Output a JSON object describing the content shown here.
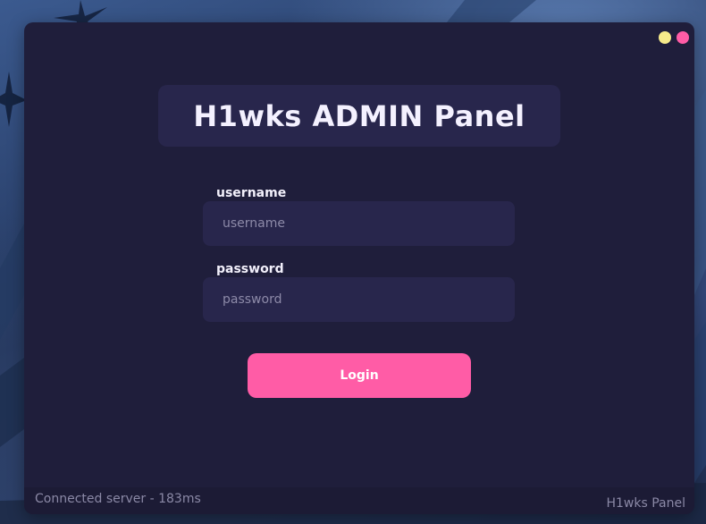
{
  "window": {
    "title": "H1wks ADMIN Panel",
    "controls": {
      "minimize_color": "#f6ea8a",
      "close_color": "#ff5ca6"
    }
  },
  "form": {
    "username": {
      "label": "username",
      "placeholder": "username",
      "value": ""
    },
    "password": {
      "label": "password",
      "placeholder": "password",
      "value": ""
    },
    "login_label": "Login"
  },
  "status_bar": {
    "connection_text": "Connected server - 183ms",
    "app_name": "H1wks Panel"
  },
  "colors": {
    "window_bg": "#1f1e3b",
    "panel_bg": "#28264c",
    "accent": "#ff5ca6",
    "muted_text": "#8b89a6"
  }
}
